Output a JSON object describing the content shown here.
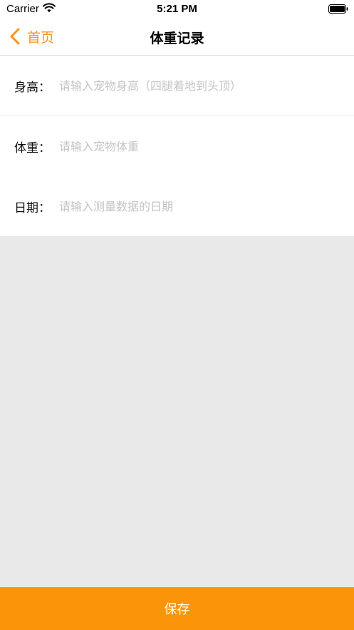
{
  "status_bar": {
    "carrier": "Carrier",
    "time": "5:21 PM"
  },
  "nav": {
    "back_label": "首页",
    "title": "体重记录",
    "accent_color": "#f7931e"
  },
  "form": {
    "fields": [
      {
        "label": "身高：",
        "placeholder": "请输入宠物身高（四腿着地到头顶）",
        "value": ""
      },
      {
        "label": "体重：",
        "placeholder": "请输入宠物体重",
        "value": ""
      },
      {
        "label": "日期：",
        "placeholder": "请输入测量数据的日期",
        "value": ""
      }
    ]
  },
  "save_button": {
    "label": "保存",
    "color": "#fc9409"
  },
  "icons": {
    "wifi": "wifi-icon",
    "battery": "battery-icon",
    "back": "chevron-left-icon"
  }
}
